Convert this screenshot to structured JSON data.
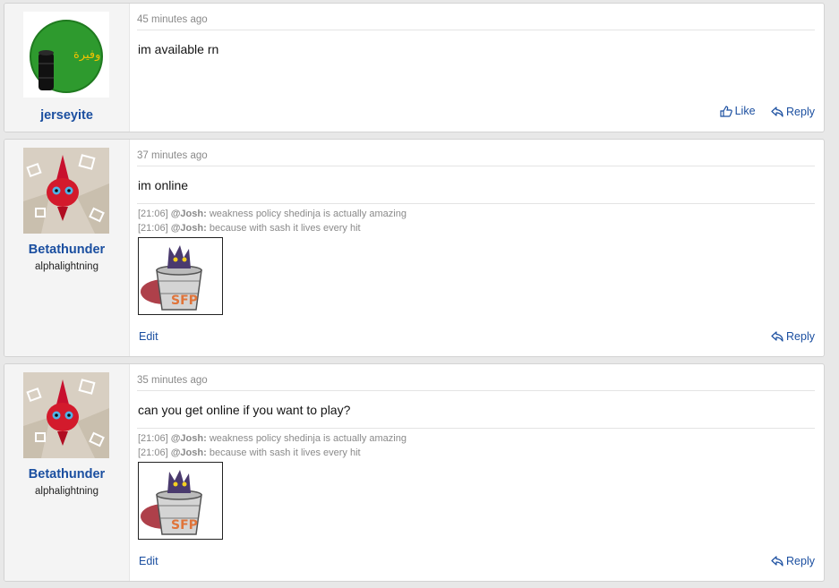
{
  "posts": [
    {
      "username": "jerseyite",
      "user_title": "",
      "date": "45 minutes ago",
      "message": "im available rn",
      "like_label": "Like",
      "reply_label": "Reply",
      "avatar_text": "وفيرة"
    },
    {
      "username": "Betathunder",
      "user_title": "alphalightning",
      "date": "37 minutes ago",
      "message": "im online",
      "signature": [
        {
          "time": "[21:06]",
          "user": "@Josh:",
          "text": "weakness policy shedinja is actually amazing"
        },
        {
          "time": "[21:06]",
          "user": "@Josh:",
          "text": "because with sash it lives every hit"
        }
      ],
      "edit_label": "Edit",
      "reply_label": "Reply"
    },
    {
      "username": "Betathunder",
      "user_title": "alphalightning",
      "date": "35 minutes ago",
      "message": "can you get online if you want to play?",
      "signature": [
        {
          "time": "[21:06]",
          "user": "@Josh:",
          "text": "weakness policy shedinja is actually amazing"
        },
        {
          "time": "[21:06]",
          "user": "@Josh:",
          "text": "because with sash it lives every hit"
        }
      ],
      "edit_label": "Edit",
      "reply_label": "Reply"
    }
  ],
  "icons": {
    "like": "thumbs-up-icon",
    "reply": "reply-arrow-icon"
  },
  "colors": {
    "link": "#1b4fa0",
    "muted": "#8a8a8a"
  }
}
